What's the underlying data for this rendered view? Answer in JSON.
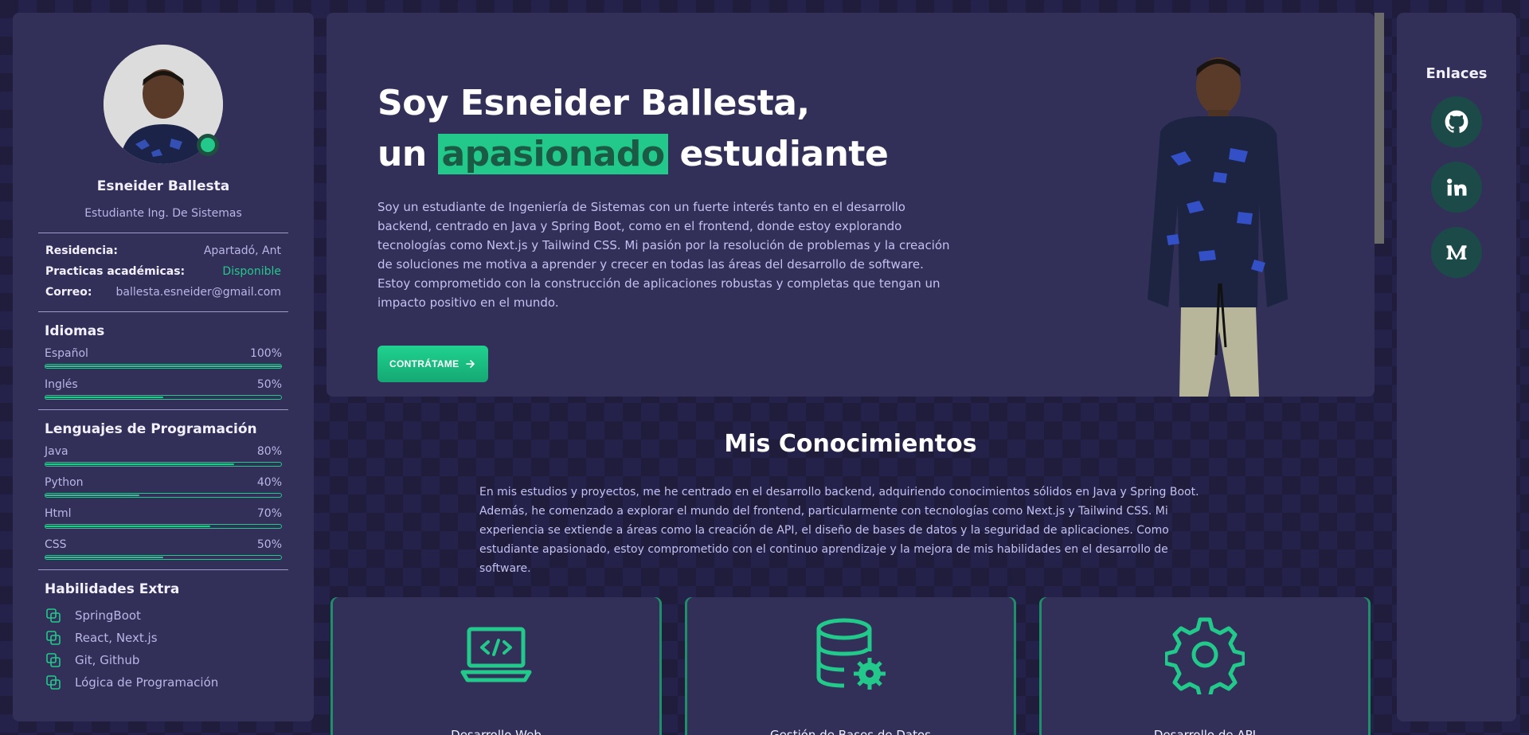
{
  "profile": {
    "name": "Esneider Ballesta",
    "role": "Estudiante Ing. De Sistemas",
    "info": [
      {
        "label": "Residencia:",
        "value": "Apartadó, Ant"
      },
      {
        "label": "Practicas académicas:",
        "value": "Disponible"
      },
      {
        "label": "Correo:",
        "value": "ballesta.esneider@gmail.com"
      }
    ]
  },
  "languages": {
    "title": "Idiomas",
    "items": [
      {
        "name": "Español",
        "percent_label": "100%",
        "level": 1.0
      },
      {
        "name": "Inglés",
        "percent_label": "50%",
        "level": 0.5
      }
    ]
  },
  "programming": {
    "title": "Lenguajes de Programación",
    "items": [
      {
        "name": "Java",
        "percent_label": "80%",
        "level": 0.8
      },
      {
        "name": "Python",
        "percent_label": "40%",
        "level": 0.4
      },
      {
        "name": "Html",
        "percent_label": "70%",
        "level": 0.7
      },
      {
        "name": "CSS",
        "percent_label": "50%",
        "level": 0.5
      }
    ]
  },
  "extras": {
    "title": "Habilidades Extra",
    "items": [
      "SpringBoot",
      "React, Next.js",
      "Git, Github",
      "Lógica de Programación"
    ]
  },
  "hero": {
    "line1": "Soy Esneider Ballesta,",
    "line2_prefix": "un",
    "line2_highlight": "apasionado",
    "line2_suffix": "estudiante",
    "description": "Soy un estudiante de Ingeniería de Sistemas con un fuerte interés tanto en el desarrollo backend, centrado en Java y Spring Boot, como en el frontend, donde estoy explorando tecnologías como Next.js y Tailwind CSS. Mi pasión por la resolución de problemas y la creación de soluciones me motiva a aprender y crecer en todas las áreas del desarrollo de software. Estoy comprometido con la construcción de aplicaciones robustas y completas que tengan un impacto positivo en el mundo.",
    "cta_label": "CONTRÁTAME"
  },
  "knowledge": {
    "title": "Mis Conocimientos",
    "description": "En mis estudios y proyectos, me he centrado en el desarrollo backend, adquiriendo conocimientos sólidos en Java y Spring Boot. Además, he comenzado a explorar el mundo del frontend, particularmente con tecnologías como Next.js y Tailwind CSS. Mi experiencia se extiende a áreas como la creación de API, el diseño de bases de datos y la seguridad de aplicaciones. Como estudiante apasionado, estoy comprometido con el continuo aprendizaje y la mejora de mis habilidades en el desarrollo de software.",
    "cards": [
      {
        "title": "Desarrollo Web",
        "icon": "laptop-code-icon"
      },
      {
        "title": "Gestión de Bases de Datos",
        "icon": "database-gear-icon"
      },
      {
        "title": "Desarrollo de API",
        "icon": "gear-icon"
      }
    ]
  },
  "links": {
    "title": "Enlaces",
    "items": [
      {
        "icon": "github-icon"
      },
      {
        "icon": "linkedin-icon"
      },
      {
        "icon": "medium-icon"
      }
    ]
  },
  "colors": {
    "accent": "#22c98b",
    "panel": "#323058",
    "background": "#1f1d3b"
  }
}
